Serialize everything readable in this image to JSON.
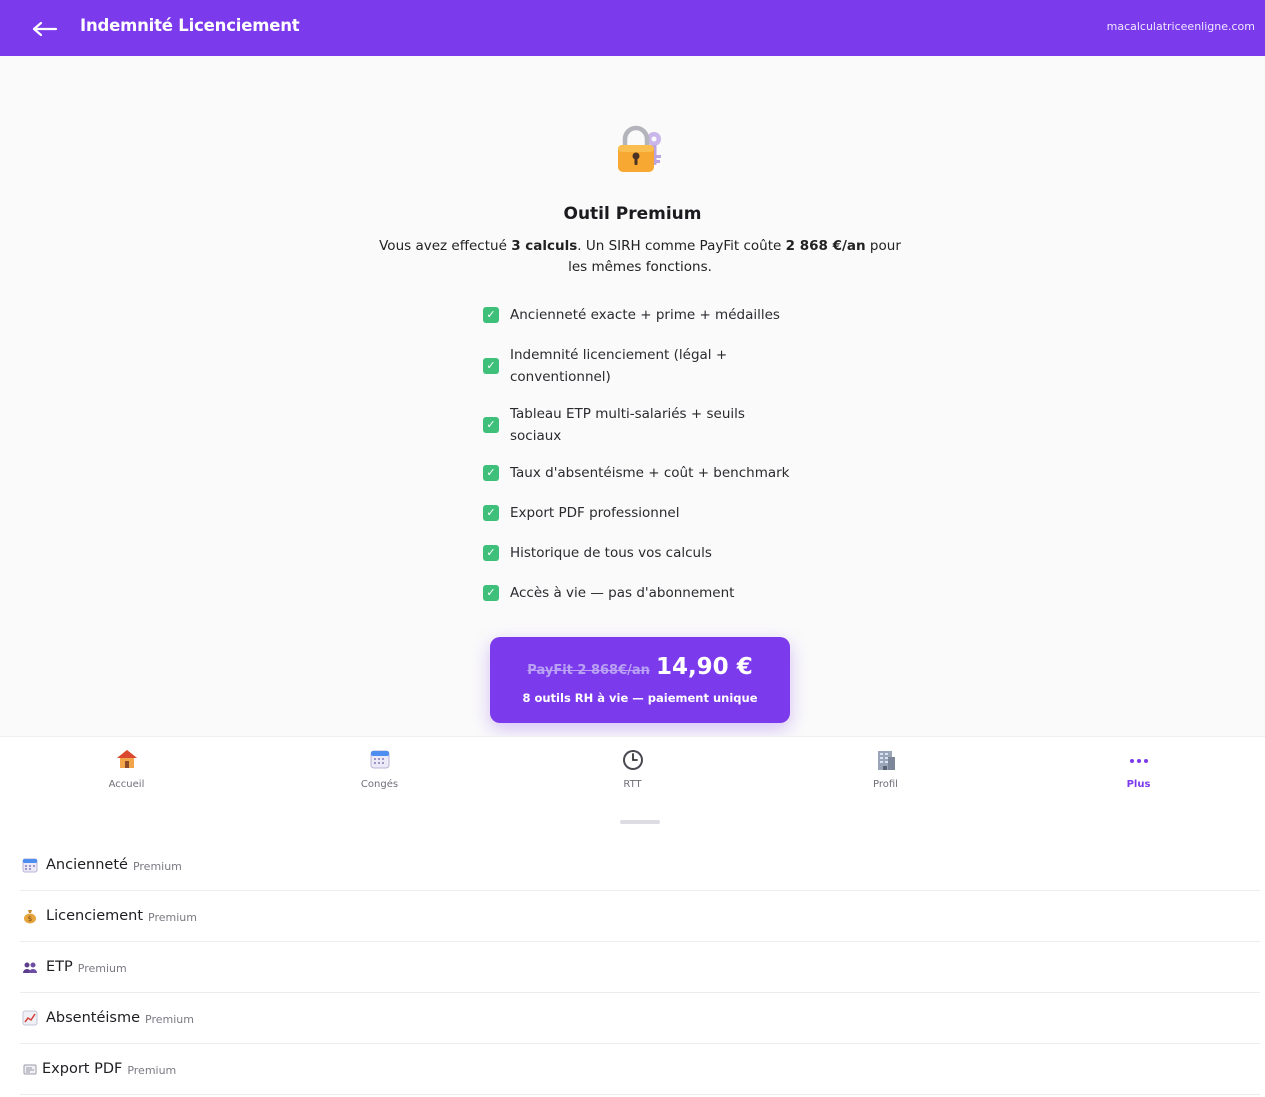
{
  "header": {
    "back_icon": "arrow-left-icon",
    "title": "Indemnité Licenciement",
    "site": "macalculatriceenligne.com"
  },
  "paywall": {
    "lock_icon": "locked-with-key-icon",
    "title": "Outil Premium",
    "subtitle_pre": "Vous avez effectué ",
    "subtitle_calcs": "3 calculs",
    "subtitle_mid": ". Un SIRH comme PayFit coûte ",
    "subtitle_price": "2 868 €/an",
    "subtitle_post": " pour les mêmes fonctions.",
    "features": [
      "Ancienneté exacte + prime + médailles",
      "Indemnité licenciement (légal + conventionnel)",
      "Tableau ETP multi-salariés + seuils sociaux",
      "Taux d'absentéisme + coût + benchmark",
      "Export PDF professionnel",
      "Historique de tous vos calculs",
      "Accès à vie — pas d'abonnement"
    ],
    "cta": {
      "old_price": "PayFit 2 868€/an",
      "price": "14,90 €",
      "subtitle": "8 outils RH à vie — paiement unique"
    }
  },
  "bottom_nav": [
    {
      "label": "Accueil",
      "icon": "house-icon"
    },
    {
      "label": "Congés",
      "icon": "calendar-icon"
    },
    {
      "label": "RTT",
      "icon": "clock-icon"
    },
    {
      "label": "Profil",
      "icon": "office-building-icon"
    },
    {
      "label": "Plus",
      "icon": "more-dots-icon",
      "active": true
    }
  ],
  "menu": {
    "items": [
      {
        "label": "Ancienneté",
        "badge": "Premium",
        "icon": "calendar-icon"
      },
      {
        "label": "Licenciement",
        "badge": "Premium",
        "icon": "money-bag-icon"
      },
      {
        "label": "ETP",
        "badge": "Premium",
        "icon": "people-icon"
      },
      {
        "label": "Absentéisme",
        "badge": "Premium",
        "icon": "chart-increasing-icon"
      },
      {
        "label": "Export PDF",
        "badge": "Premium",
        "icon": "document-icon"
      }
    ]
  },
  "colors": {
    "brand": "#7c3aed",
    "check": "#3fc07a",
    "background": "#fafafa"
  }
}
